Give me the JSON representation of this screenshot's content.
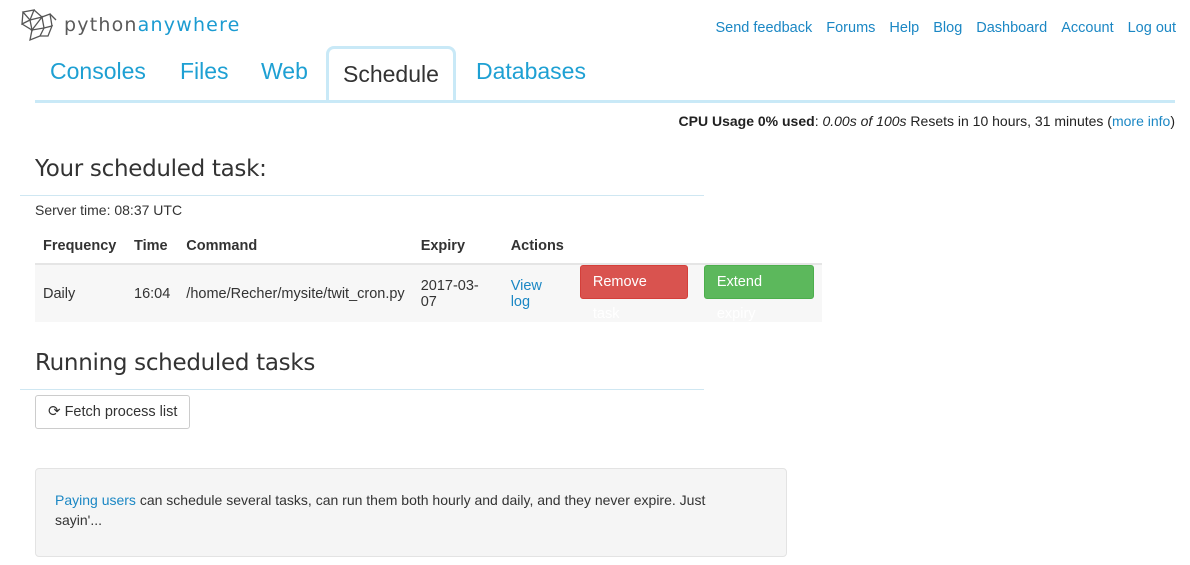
{
  "logo": {
    "part1": "python",
    "part2": "anywhere"
  },
  "topnav": [
    "Send feedback",
    "Forums",
    "Help",
    "Blog",
    "Dashboard",
    "Account",
    "Log out"
  ],
  "tabs": [
    "Consoles",
    "Files",
    "Web",
    "Schedule",
    "Databases"
  ],
  "active_tab": "Schedule",
  "cpu": {
    "label": "CPU Usage 0% used",
    "colon": ": ",
    "value": "0.00s of 100s",
    "resets": " Resets in 10 hours, 31 minutes (",
    "more_info": "more info",
    "close": ")"
  },
  "scheduled": {
    "heading": "Your scheduled task:",
    "server_time": "Server time: 08:37 UTC",
    "columns": [
      "Frequency",
      "Time",
      "Command",
      "Expiry",
      "Actions"
    ],
    "rows": [
      {
        "frequency": "Daily",
        "time": "16:04",
        "command": "/home/Recher/mysite/twit_cron.py",
        "expiry": "2017-03-07",
        "view_log": "View log",
        "remove": "Remove task",
        "extend": "Extend expiry"
      }
    ]
  },
  "running": {
    "heading": "Running scheduled tasks",
    "fetch_label": "Fetch process list",
    "fetch_icon": "refresh-icon"
  },
  "info": {
    "link": "Paying users",
    "text": " can schedule several tasks, can run them both hourly and daily, and they never expire. Just sayin'..."
  },
  "colors": {
    "brand_blue": "#1b9bd1",
    "link": "#1b87c4",
    "danger": "#d9534f",
    "success": "#5cb85c"
  }
}
